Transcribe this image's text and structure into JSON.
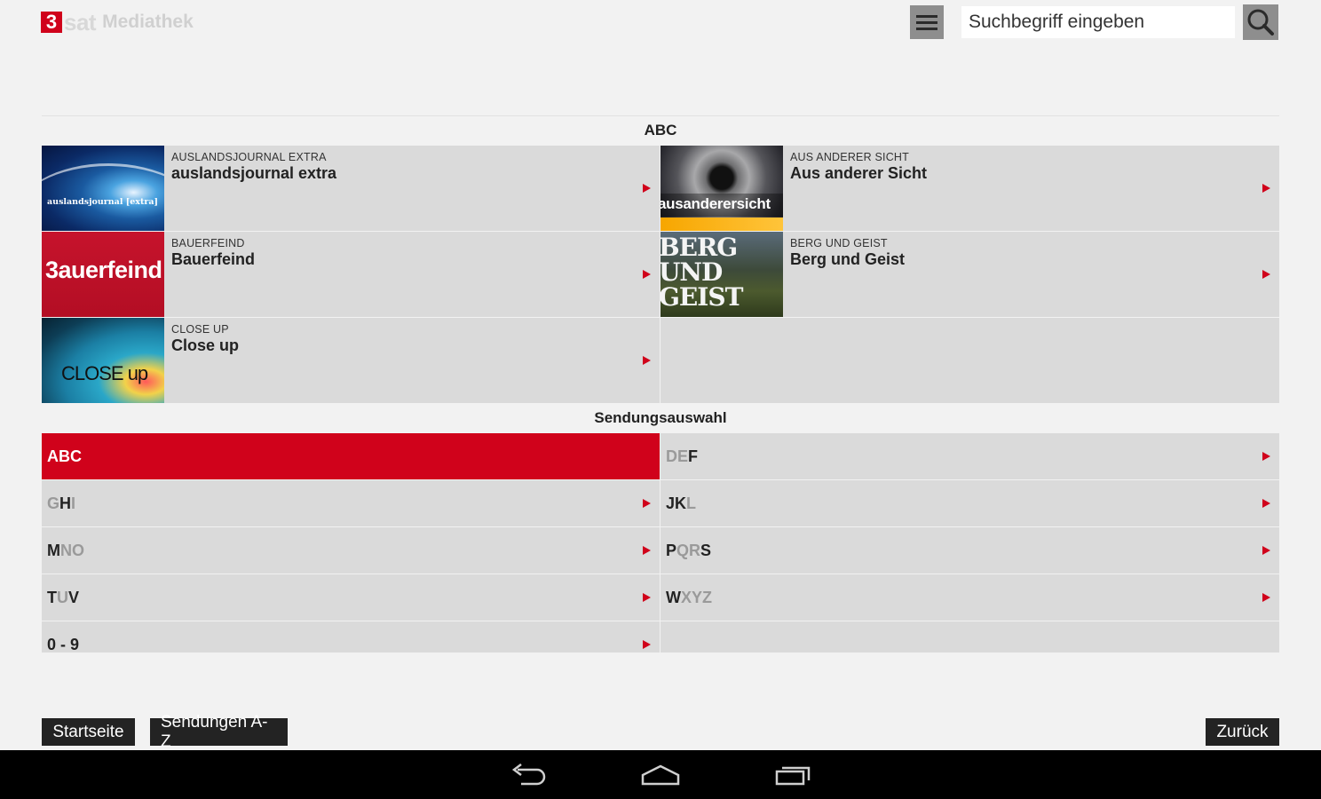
{
  "header": {
    "logo_mark": "3",
    "logo_sat": "sat",
    "logo_text": "Mediathek",
    "menu_icon": "hamburger-menu-icon",
    "search_placeholder": "Suchbegriff eingeben",
    "search_value": "",
    "search_icon": "magnifier-icon"
  },
  "section_programs": {
    "title": "ABC",
    "items": [
      {
        "thumb_text": "auslandsjournal [extra]",
        "subtitle": "AUSLANDSJOURNAL EXTRA",
        "title": "auslandsjournal extra"
      },
      {
        "thumb_text": "ausanderersicht",
        "subtitle": "AUS ANDERER SICHT",
        "title": "Aus anderer Sicht"
      },
      {
        "thumb_text": "3auerfeind",
        "subtitle": "BAUERFEIND",
        "title": "Bauerfeind"
      },
      {
        "thumb_text": "BERG UND GEIST",
        "subtitle": "BERG UND GEIST",
        "title": "Berg und Geist"
      },
      {
        "thumb_text": "CLOSE up",
        "subtitle": "CLOSE UP",
        "title": "Close up"
      }
    ]
  },
  "section_select": {
    "title": "Sendungsauswahl",
    "letters": [
      {
        "label": "ABC",
        "selected": true
      },
      {
        "label": "DEF"
      },
      {
        "label": "GHI"
      },
      {
        "label": "JKL"
      },
      {
        "label": "MNO"
      },
      {
        "label": "PQRS"
      },
      {
        "label": "TUV"
      },
      {
        "label": "WXYZ"
      },
      {
        "label": "0 - 9"
      }
    ]
  },
  "footer": {
    "home": "Startseite",
    "az": "Sendungen A-Z",
    "back": "Zurück"
  },
  "navbar": {
    "back_icon": "back-icon",
    "home_icon": "home-icon",
    "recents_icon": "recents-icon"
  },
  "colors": {
    "accent": "#d0021b",
    "tile_bg": "#dadada",
    "page_bg": "#f2f2f2",
    "button_bg": "#232323"
  }
}
